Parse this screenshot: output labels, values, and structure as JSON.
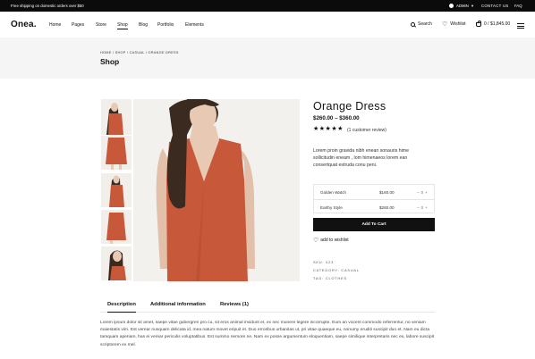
{
  "topbar": {
    "shipping": "Free shipping on domestic orders over $50",
    "admin": "ADMIN",
    "contact": "CONTACT US",
    "faq": "FAQ"
  },
  "header": {
    "logo": "Onea.",
    "nav": [
      "Home",
      "Pages",
      "Store",
      "Shop",
      "Blog",
      "Portfolio",
      "Elements"
    ],
    "active_nav": "Shop",
    "search": "Search",
    "wishlist": "Wishlist",
    "cart": "0 / $1,845.00"
  },
  "breadcrumb": [
    "HOME",
    "SHOP",
    "CASUAL",
    "ORANGE DRESS"
  ],
  "breadcrumb_text": "HOME  /  SHOP  /  CASUAL  /  ORANGE DRESS",
  "page_title": "Shop",
  "product": {
    "name": "Orange Dress",
    "price": "$260.00 – $360.00",
    "rating": 5,
    "stars": "★★★★★",
    "review_text": "(1 customer review)",
    "description": "Lorem proin gravida nibh enean sonauris hime sollicitudin eneam , lom himenaeos lorem ean consertquat estruda conu peni.",
    "grouped": [
      {
        "name": "Golden Watch",
        "price": "$160.00",
        "qty": "0"
      },
      {
        "name": "Earthy Style",
        "price": "$260.00",
        "qty": "0"
      }
    ],
    "add_to_cart": "Add To Cart",
    "add_to_wishlist": "add to wishlist",
    "sku": "SKU: 023",
    "category": "CATEGORY: CASUAL",
    "tag": "TAG: CLOTHES"
  },
  "tabs": [
    "Description",
    "Additional information",
    "Reviews (1)"
  ],
  "long_description": "Lorem ipsum dolor sit amet, saepe vitae gubergren pro cu, sit eros animal invidunt et, ex nec munere legere incorrupte. Eum an vocent commodo referrentur, no veniam maiestatis vim. Est verear nusquam delicata id, mea natum movet eripuit et. Duo erroribus urbanitas ut, pri vitae quaeque eu, nonumy eruditi suscipit duo et. Nam eu dicta tamquam aperiam, has ei verear periculis voluptatibus. Est summo nemore ne. Nam ex posse argumentum eloquentiam, saepe similique interpretaris nec ex, labore suscipit scriptorem ex mel.",
  "colors": {
    "dress": "#c8583a",
    "hair": "#3a2a20",
    "skin": "#e8c9b4",
    "bg_band": "#f5f5f5"
  }
}
